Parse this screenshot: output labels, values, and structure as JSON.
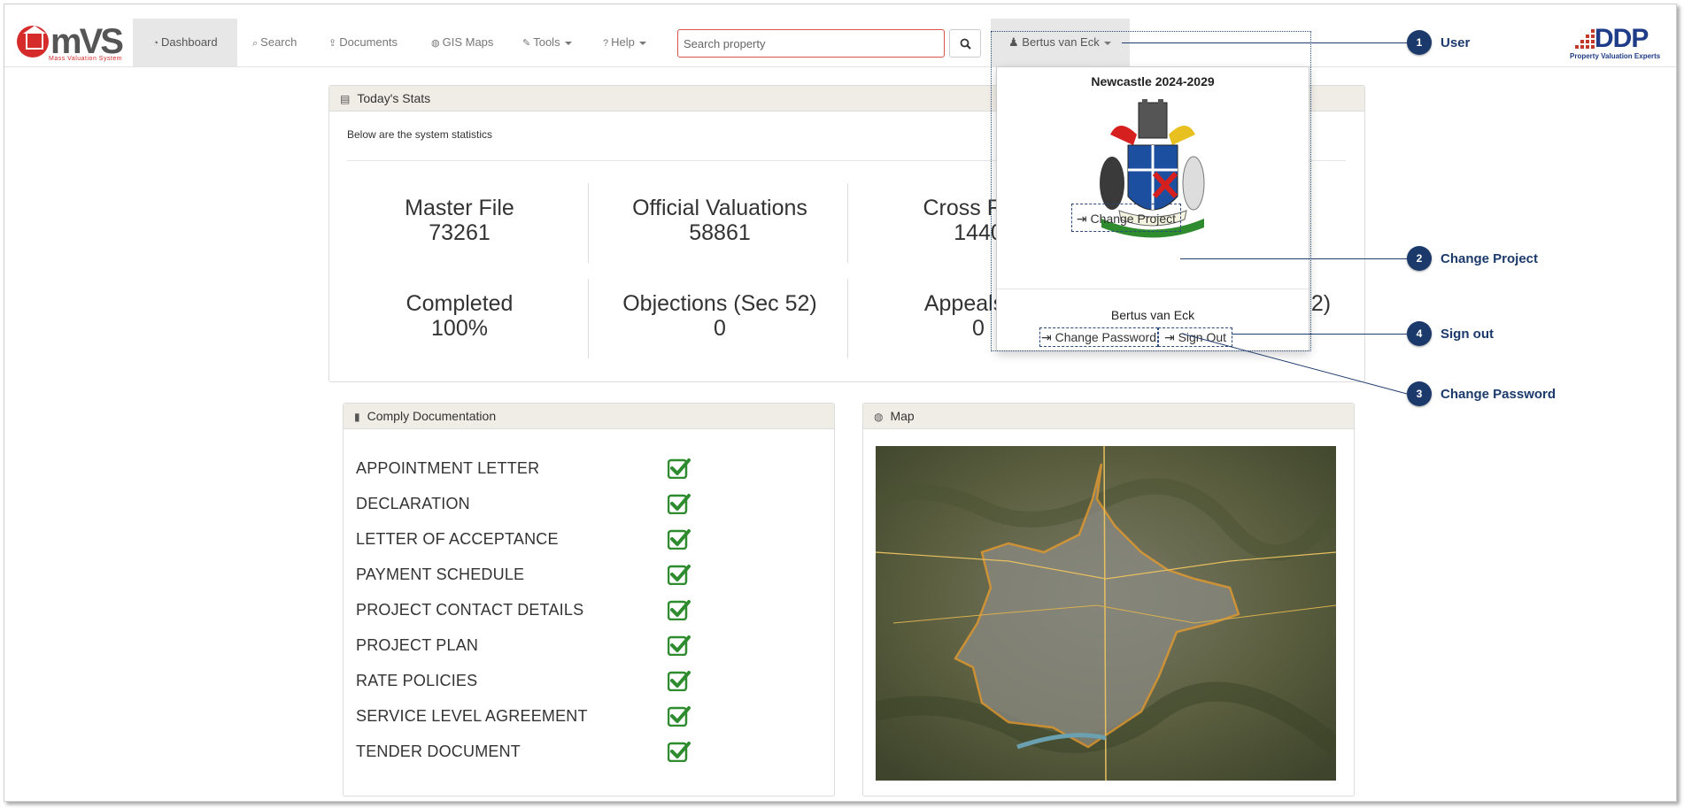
{
  "app": {
    "logo_text": "mVS",
    "logo_sub": "Mass Valuation System",
    "brand_right": "DDP",
    "brand_right_sub": "Property Valuation Experts"
  },
  "nav": {
    "dashboard": "Dashboard",
    "search": "Search",
    "documents": "Documents",
    "gis_maps": "GIS Maps",
    "tools": "Tools",
    "help": "Help",
    "search_placeholder": "Search property",
    "user": "Bertus van Eck"
  },
  "stats": {
    "title": "Today's Stats",
    "description": "Below are the system statistics",
    "items": [
      {
        "label": "Master File",
        "value": "73261"
      },
      {
        "label": "Official Valuations",
        "value": "58861"
      },
      {
        "label": "Cross Refe",
        "value": "1440"
      },
      {
        "label": "Completed",
        "value": "100%"
      },
      {
        "label": "Objections (Sec 52)",
        "value": "0"
      },
      {
        "label": "Appeals (S",
        "value": "0"
      },
      {
        "label": "2)",
        "value": ""
      }
    ]
  },
  "comply": {
    "title": "Comply Documentation",
    "documents": [
      "APPOINTMENT LETTER",
      "DECLARATION",
      "LETTER OF ACCEPTANCE",
      "PAYMENT SCHEDULE",
      "PROJECT CONTACT DETAILS",
      "PROJECT PLAN",
      "RATE POLICIES",
      "SERVICE LEVEL AGREEMENT",
      "TENDER DOCUMENT"
    ]
  },
  "map": {
    "title": "Map"
  },
  "dropdown": {
    "project": "Newcastle 2024-2029",
    "change_project": "Change Project",
    "user_name": "Bertus van Eck",
    "change_password": "Change Password",
    "sign_out": "Sign Out"
  },
  "callouts": [
    {
      "num": "1",
      "label": "User"
    },
    {
      "num": "2",
      "label": "Change Project"
    },
    {
      "num": "3",
      "label": "Change Password"
    },
    {
      "num": "4",
      "label": "Sign out"
    }
  ],
  "colors": {
    "accent": "#1b3a6b",
    "check": "#2e8b2e",
    "panel_head": "#f0ede6"
  }
}
